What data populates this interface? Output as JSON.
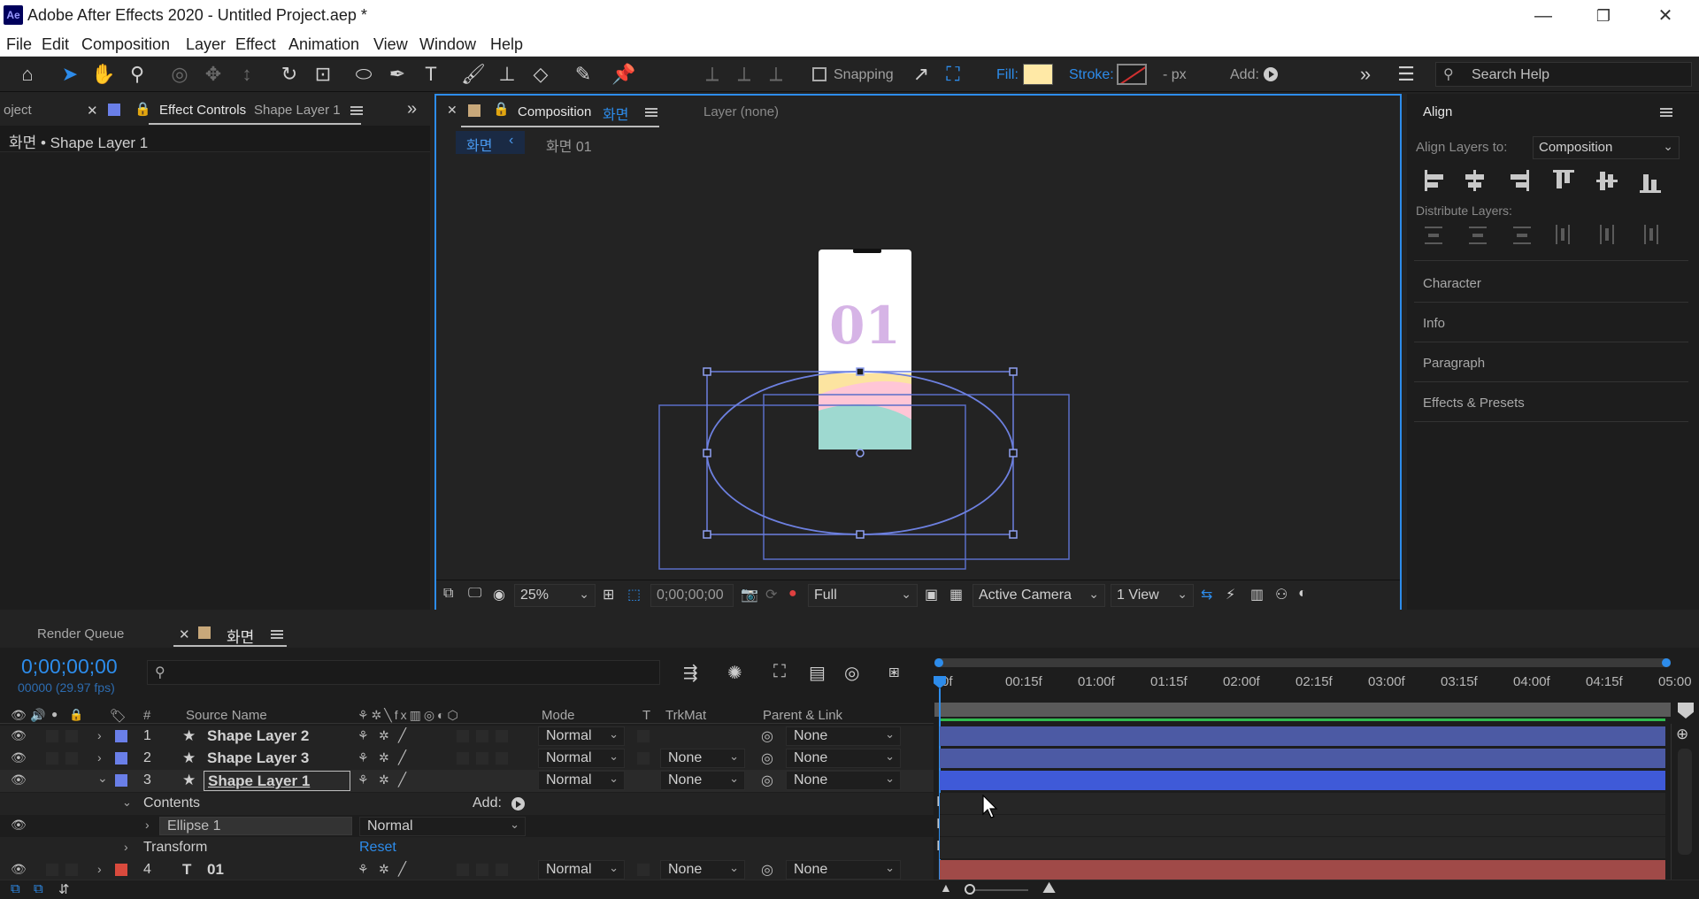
{
  "window": {
    "title": "Adobe After Effects 2020 - Untitled Project.aep *",
    "logo_text": "Ae",
    "minimize": "—",
    "restore": "❐",
    "close": "✕"
  },
  "menu": [
    "File",
    "Edit",
    "Composition",
    "Layer",
    "Effect",
    "Animation",
    "View",
    "Window",
    "Help"
  ],
  "toolbar": {
    "snapping_label": "Snapping",
    "fill_label": "Fill:",
    "fill_color": "#ffe9a6",
    "stroke_label": "Stroke:",
    "stroke_unit": "- px",
    "add_label": "Add:",
    "search_placeholder": "Search Help"
  },
  "left_panel": {
    "tab_project": "oject",
    "tab_effect_controls": "Effect Controls",
    "tab_effect_controls_layer": "Shape Layer 1",
    "breadcrumb": "화면 • Shape Layer 1"
  },
  "comp_panel": {
    "tab_label": "Composition",
    "tab_comp_name": "화면",
    "layer_tab": "Layer (none)",
    "breadcrumb_active": "화면",
    "breadcrumb_next": "화면 01",
    "phone_text": "01",
    "zoom": "25%",
    "timecode": "0;00;00;00",
    "resolution": "Full",
    "camera": "Active Camera",
    "views": "1 View"
  },
  "align_panel": {
    "title": "Align",
    "align_layers_to": "Align Layers to:",
    "align_target": "Composition",
    "distribute_label": "Distribute Layers:",
    "sections": [
      "Character",
      "Info",
      "Paragraph",
      "Effects & Presets"
    ]
  },
  "timeline": {
    "tab_render_queue": "Render Queue",
    "tab_comp": "화면",
    "timecode": "0;00;00;00",
    "fps": "00000 (29.97 fps)",
    "search_icon": "search-icon",
    "columns": {
      "num": "#",
      "source": "Source Name",
      "mode": "Mode",
      "t": "T",
      "trkmat": "TrkMat",
      "parent": "Parent & Link"
    },
    "ruler": [
      "0f",
      "00:15f",
      "01:00f",
      "01:15f",
      "02:00f",
      "02:15f",
      "03:00f",
      "03:15f",
      "04:00f",
      "04:15f",
      "05:00"
    ],
    "layers": [
      {
        "num": "1",
        "name": "Shape Layer 2",
        "mode": "Normal",
        "trkmat": "",
        "parent": "None",
        "color": "#6a7fe8",
        "type": "star"
      },
      {
        "num": "2",
        "name": "Shape Layer 3",
        "mode": "Normal",
        "trkmat": "None",
        "parent": "None",
        "color": "#6a7fe8",
        "type": "star"
      },
      {
        "num": "3",
        "name": "Shape Layer 1",
        "mode": "Normal",
        "trkmat": "None",
        "parent": "None",
        "color": "#6a7fe8",
        "type": "star"
      },
      {
        "num": "4",
        "name": "01",
        "mode": "Normal",
        "trkmat": "None",
        "parent": "None",
        "color": "#d94a3d",
        "type": "T"
      }
    ],
    "contents_label": "Contents",
    "add_label": "Add:",
    "ellipse_label": "Ellipse 1",
    "ellipse_mode": "Normal",
    "transform_label": "Transform",
    "reset_label": "Reset"
  }
}
